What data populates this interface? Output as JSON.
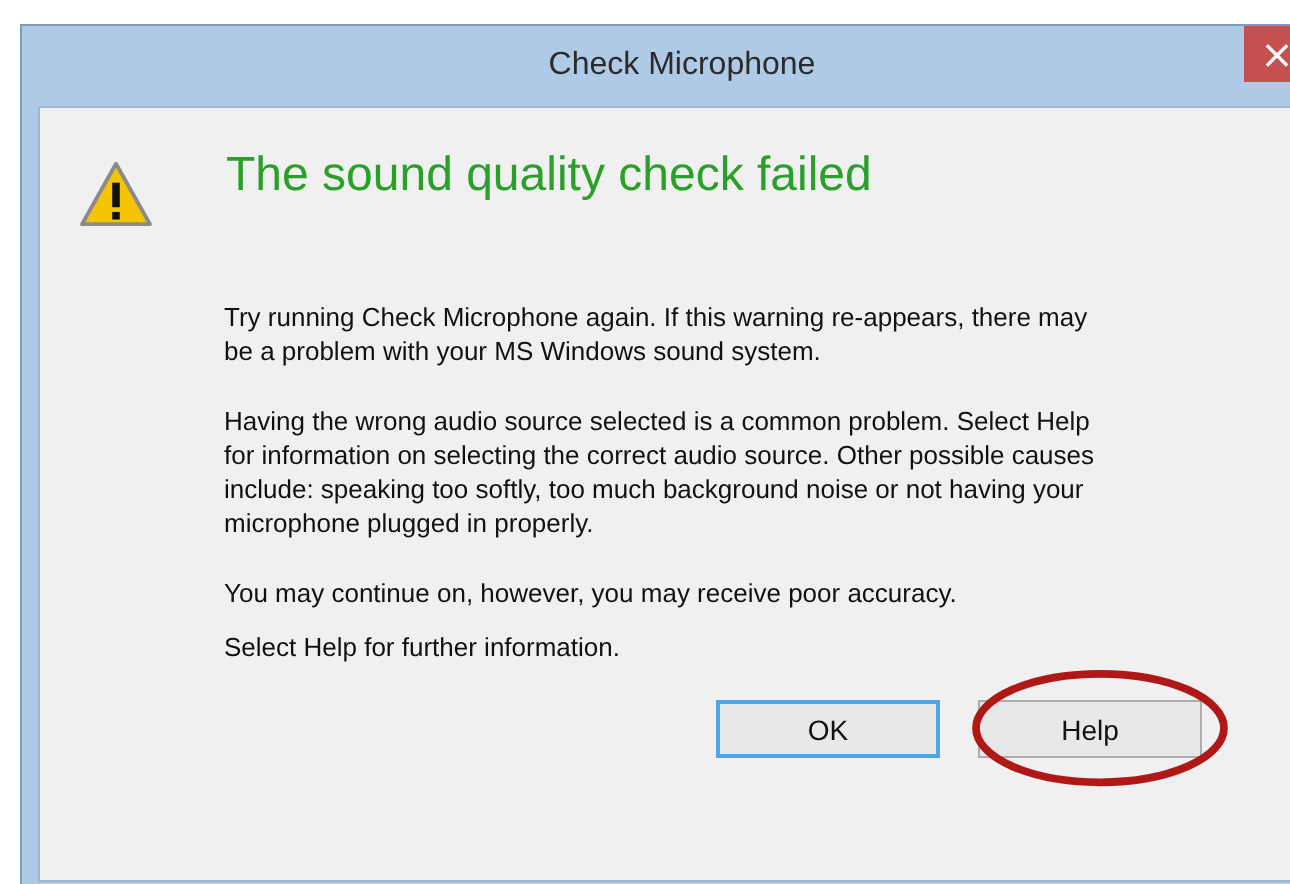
{
  "window": {
    "title": "Check Microphone",
    "close": "×"
  },
  "heading": "The sound quality check failed",
  "paragraphs": [
    "Try running Check Microphone again. If this warning re-appears, there may be a problem with your MS Windows sound system.",
    "Having the wrong audio source selected is a common problem. Select Help for information on selecting the correct audio source. Other possible causes include: speaking too softly, too much background noise or not having your microphone plugged in properly.",
    "You may continue on, however, you may receive poor accuracy.",
    "Select Help for further information."
  ],
  "buttons": [
    {
      "label": "OK",
      "default": true,
      "circled": false
    },
    {
      "label": "Help",
      "default": false,
      "circled": true
    }
  ]
}
